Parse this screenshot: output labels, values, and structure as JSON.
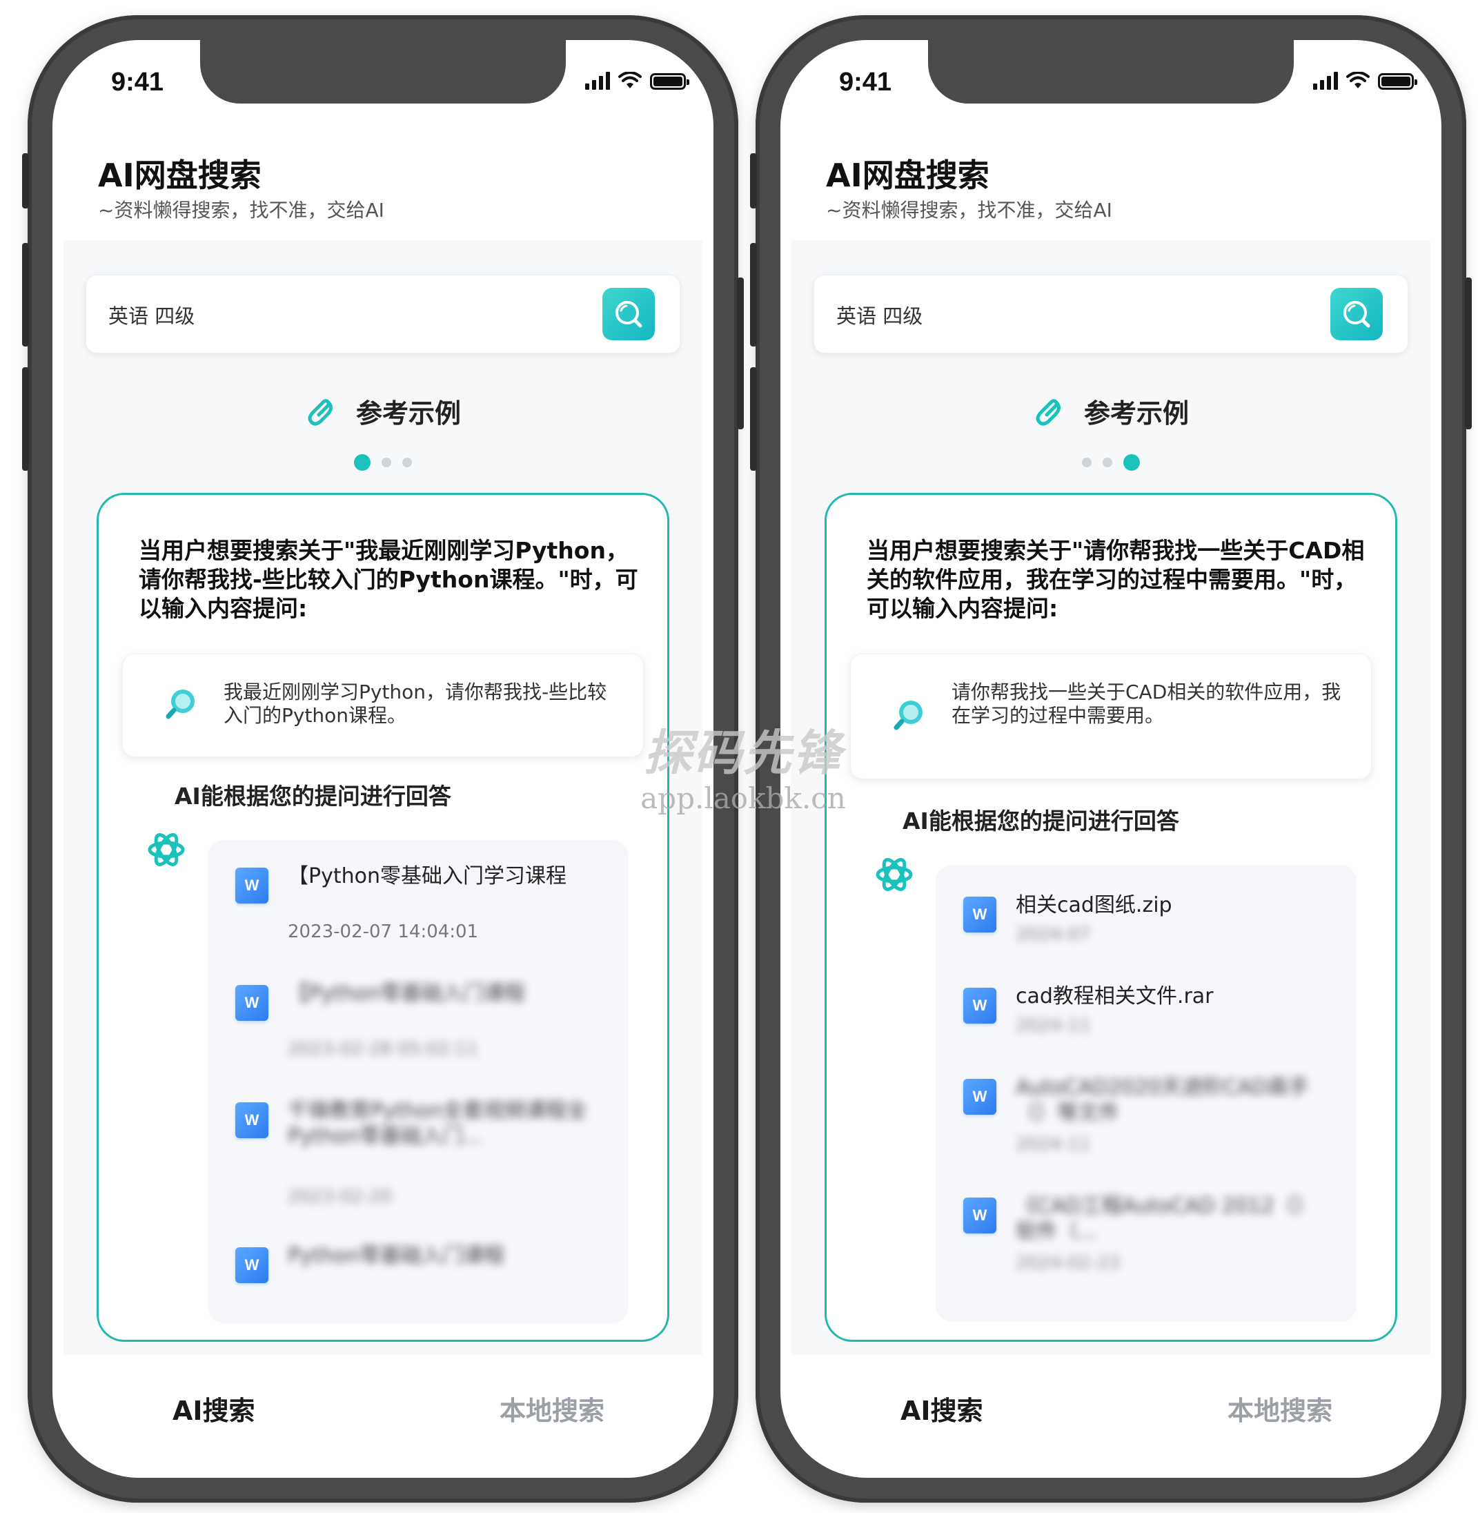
{
  "phones": [
    {
      "status_time": "9:41",
      "app_title": "AI网盘搜索",
      "app_subtitle": "~资料懒得搜索，找不准，交给AI",
      "search_value": "英语 四级",
      "ref_title": "参考示例",
      "active_dot": 0,
      "card_heading": "当用户想要搜索关于\"我最近刚刚学习Python，请你帮我找-些比较入门的Python课程。\"时，可以输入内容提问:",
      "query_text": "我最近刚刚学习Python，请你帮我找-些比较入门的Python课程。",
      "answer_label": "AI能根据您的提问进行回答",
      "results": [
        {
          "name": "【Python零基础入门学习课程",
          "date": "2023-02-07 14:04:01"
        },
        {
          "name": "【Python零基础入门课程",
          "date": "2023-02-28 05:02:11"
        },
        {
          "name": "千锋教育Python全套视频课程全Python零基础入门...",
          "date": "2023-02-20"
        },
        {
          "name": "Python零基础入门课程",
          "date": ""
        }
      ],
      "tab_ai": "AI搜索",
      "tab_local": "本地搜索"
    },
    {
      "status_time": "9:41",
      "app_title": "AI网盘搜索",
      "app_subtitle": "~资料懒得搜索，找不准，交给AI",
      "search_value": "英语 四级",
      "ref_title": "参考示例",
      "active_dot": 2,
      "card_heading": "当用户想要搜索关于\"请你帮我找一些关于CAD相关的软件应用，我在学习的过程中需要用。\"时，可以输入内容提问:",
      "query_text": "请你帮我找一些关于CAD相关的软件应用，我在学习的过程中需要用。",
      "answer_label": "AI能根据您的提问进行回答",
      "results": [
        {
          "name": "相关cad图纸.zip",
          "date": "2024-07"
        },
        {
          "name": "cad教程相关文件.rar",
          "date": "2024-11"
        },
        {
          "name": "AutoCAD2020天进阶CAD高手（）等文件",
          "date": "2024-11"
        },
        {
          "name": "《CAD工程AutoCAD 2012（）软件（...",
          "date": "2024-02-23"
        }
      ],
      "tab_ai": "AI搜索",
      "tab_local": "本地搜索"
    }
  ],
  "watermark": {
    "main": "探码先锋",
    "url": "app.laokbk.cn"
  },
  "colors": {
    "accent": "#1bc1bb",
    "card_border": "#24b7b0",
    "doc_icon": "#2f7bf0"
  }
}
